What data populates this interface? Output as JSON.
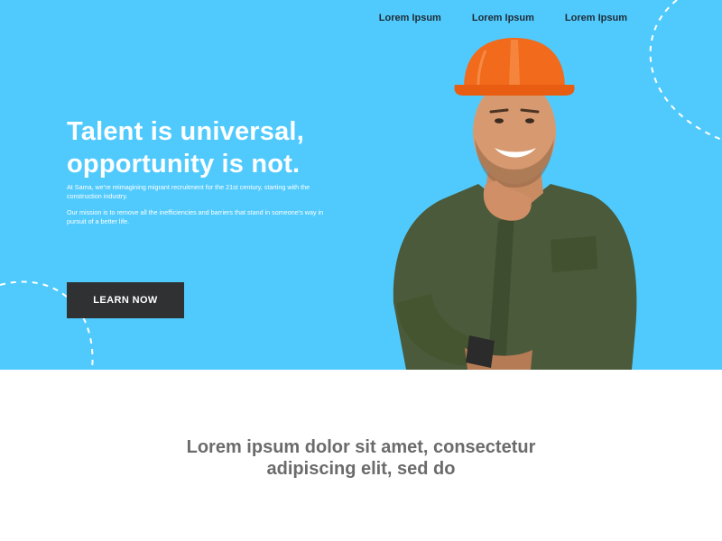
{
  "nav": {
    "items": [
      {
        "label": "Lorem Ipsum"
      },
      {
        "label": "Lorem Ipsum"
      },
      {
        "label": "Lorem Ipsum"
      }
    ]
  },
  "hero": {
    "headline_line1": "Talent is universal,",
    "headline_line2": "opportunity is not.",
    "intro": "At Sama, we’re reimagining migrant recruitment for the 21st century, starting with the construction industry.",
    "mission": "Our mission is to remove all the inefficiencies and barriers that stand in someone’s way in pursuit of a better life.",
    "cta_label": "LEARN NOW"
  },
  "content": {
    "heading_line1": "Lorem ipsum dolor sit amet, consectetur",
    "heading_line2": "adipiscing elit, sed do"
  },
  "colors": {
    "hero_background": "#50cafd",
    "cta_background": "#2f3133",
    "helmet": "#f26a1b",
    "shirt": "#4a5a3a",
    "heading_text": "#6b6b6b"
  },
  "icons": {
    "worker_photo": "construction-worker-image",
    "decoration": "dashed-circle-decoration"
  }
}
